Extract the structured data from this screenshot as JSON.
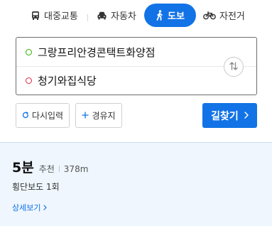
{
  "modes": [
    {
      "id": "transit",
      "label": "대중교통",
      "icon": "bus-icon",
      "active": false
    },
    {
      "id": "car",
      "label": "자동차",
      "icon": "car-icon",
      "active": false
    },
    {
      "id": "walk",
      "label": "도보",
      "icon": "walking-person-icon",
      "active": true
    },
    {
      "id": "bike",
      "label": "자전거",
      "icon": "bicycle-icon",
      "active": false
    }
  ],
  "route": {
    "start": "그랑프리안경콘택트화양점",
    "end": "청기와집식당",
    "swap_icon": "swap-arrows-icon"
  },
  "actions": {
    "reset_label": "다시입력",
    "waypoint_label": "경유지",
    "search_label": "길찾기"
  },
  "result": {
    "duration": "5분",
    "recommend": "추천",
    "distance": "378m",
    "crosswalk": "횡단보도 1회",
    "detail_label": "상세보기"
  },
  "colors": {
    "accent": "#1273e6",
    "start_dot": "#2db400",
    "end_dot": "#e8263c",
    "result_bg": "#eff6fd"
  }
}
